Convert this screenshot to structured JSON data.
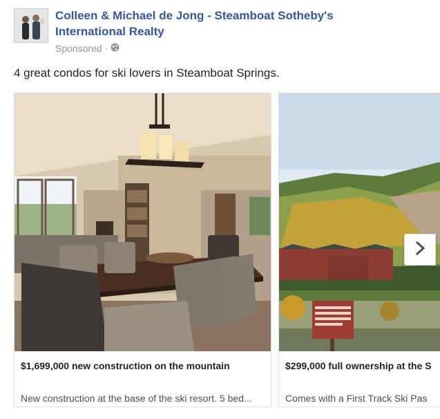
{
  "page": {
    "name": "Colleen & Michael de Jong - Steamboat Sotheby's International Realty",
    "sponsored_label": "Sponsored",
    "separator": "·",
    "audience_icon": "globe-icon"
  },
  "post": {
    "text": "4 great condos for ski lovers in Steamboat Springs."
  },
  "carousel": {
    "next_icon": "chevron-right-icon",
    "cards": [
      {
        "title": "$1,699,000 new construction on the mountain",
        "description": "New construction at the base of the ski resort. 5 bed..."
      },
      {
        "title": "$299,000 full ownership at the S",
        "description": "Comes with a First Track Ski Pas"
      }
    ]
  },
  "colors": {
    "link_blue": "#365899",
    "meta_gray": "#90949c",
    "text": "#1d2129",
    "border": "#dddfe2"
  }
}
